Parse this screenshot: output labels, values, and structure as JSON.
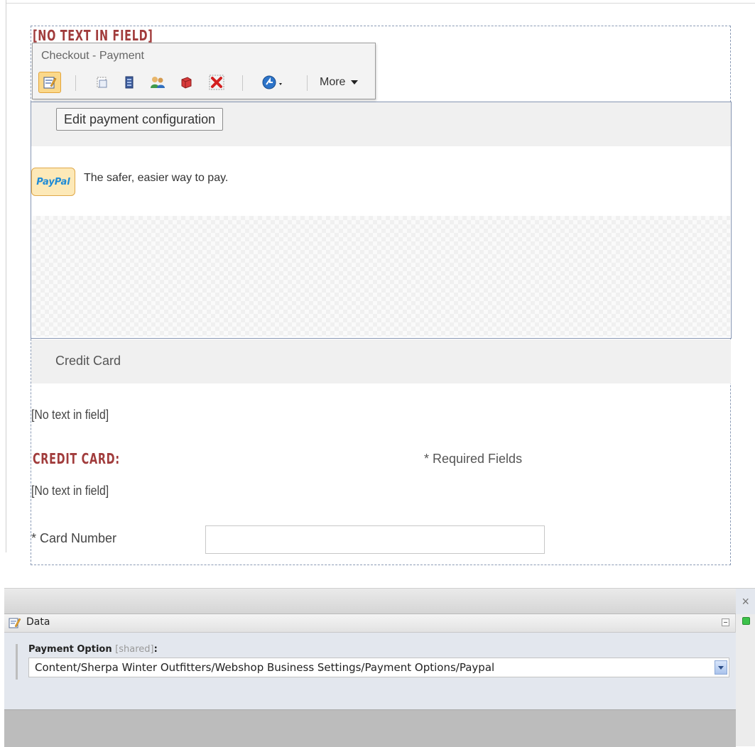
{
  "page": {
    "heading_top": "[NO TEXT IN FIELD]",
    "credit_card_band_label": "Credit Card",
    "no_text_1": "[No text in field]",
    "credit_card_heading": "CREDIT CARD:",
    "required_fields": "* Required Fields",
    "no_text_2": "[No text in field]",
    "card_number_label": "* Card Number",
    "card_number_value": ""
  },
  "toolbar": {
    "title": "Checkout - Payment",
    "more_label": "More",
    "icons": [
      "edit-icon",
      "select-icon",
      "datasource-icon",
      "users-icon",
      "red-box-icon",
      "delete-icon",
      "navigate-icon"
    ]
  },
  "rendering": {
    "tooltip_label": "Edit payment configuration",
    "paypal_logo_text": "PayPal",
    "paypal_tagline": "The safer, easier way to pay."
  },
  "panel": {
    "close_glyph": "×",
    "section_title": "Data",
    "field_label": "Payment Option",
    "field_shared": "[shared]",
    "field_colon": ":",
    "field_value": "Content/Sherpa Winter Outfitters/Webshop Business Settings/Payment Options/Paypal"
  },
  "colors": {
    "heading_red": "#a13c3c",
    "active_button": "#fbd88a",
    "status_green": "#3cc24a",
    "paypal_blue": "#1b3c7e"
  }
}
